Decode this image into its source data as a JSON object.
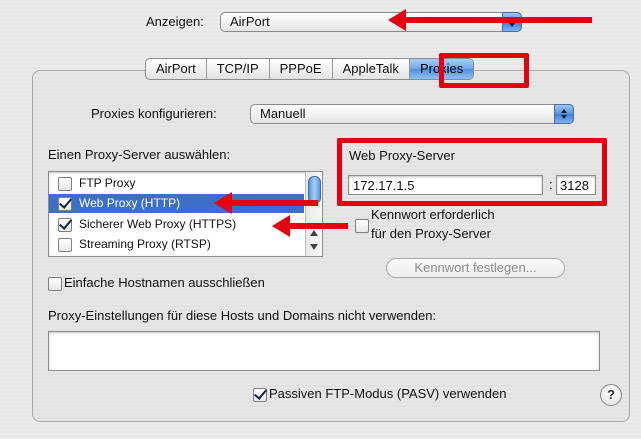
{
  "header": {
    "show_label": "Anzeigen:",
    "show_value": "AirPort"
  },
  "tabs": [
    {
      "label": "AirPort",
      "active": false
    },
    {
      "label": "TCP/IP",
      "active": false
    },
    {
      "label": "PPPoE",
      "active": false
    },
    {
      "label": "AppleTalk",
      "active": false
    },
    {
      "label": "Proxies",
      "active": true
    }
  ],
  "configure": {
    "label": "Proxies konfigurieren:",
    "value": "Manuell"
  },
  "proxy_select": {
    "label": "Einen Proxy-Server auswählen:",
    "items": [
      {
        "label": "FTP Proxy",
        "checked": false,
        "selected": false
      },
      {
        "label": "Web Proxy (HTTP)",
        "checked": true,
        "selected": true
      },
      {
        "label": "Sicherer Web Proxy (HTTPS)",
        "checked": true,
        "selected": false
      },
      {
        "label": "Streaming Proxy (RTSP)",
        "checked": false,
        "selected": false
      }
    ]
  },
  "server": {
    "label": "Web Proxy-Server",
    "address": "172.17.1.5",
    "separator": ":",
    "port": "3128"
  },
  "password": {
    "checkbox_label_1": "Kennwort erforderlich",
    "checkbox_label_2": "für den Proxy-Server",
    "checked": false,
    "set_button": "Kennwort festlegen..."
  },
  "exclude_simple": {
    "label": "Einfache Hostnamen ausschließen",
    "checked": false
  },
  "bypass": {
    "label": "Proxy-Einstellungen für diese Hosts und Domains nicht verwenden:",
    "value": ""
  },
  "passive_ftp": {
    "label": "Passiven FTP-Modus (PASV) verwenden",
    "checked": true
  },
  "help": "?",
  "colors": {
    "annotation_red": "#e40010",
    "selection_blue": "#3d6fc9",
    "aqua_blue": "#5b93df"
  }
}
